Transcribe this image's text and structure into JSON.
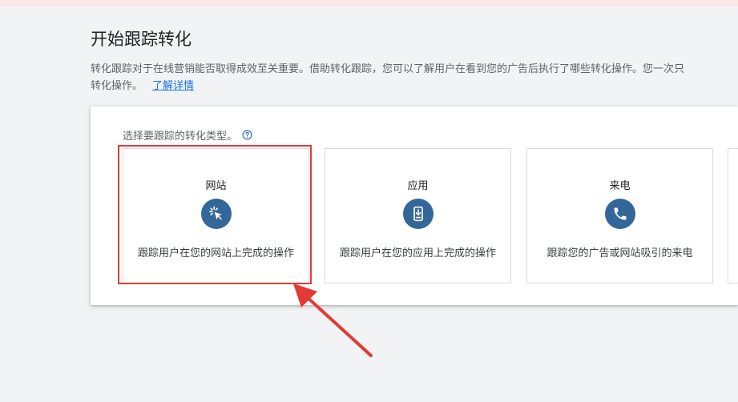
{
  "page": {
    "title": "开始跟踪转化",
    "description_line1": "转化跟踪对于在线营销能否取得成效至关重要。借助转化跟踪，您可以了解用户在看到您的广告后执行了哪些转化操作。您一次只",
    "description_line2": "转化操作。",
    "learn_more": "了解详情"
  },
  "panel": {
    "prompt": "选择要跟踪的转化类型。",
    "help_icon": "help-circle-icon",
    "cards": [
      {
        "title": "网站",
        "icon": "cursor-click-icon",
        "description": "跟踪用户在您的网站上完成的操作",
        "highlighted": true
      },
      {
        "title": "应用",
        "icon": "mobile-download-icon",
        "description": "跟踪用户在您的应用上完成的操作",
        "highlighted": false
      },
      {
        "title": "来电",
        "icon": "phone-icon",
        "description": "跟踪您的广告或网站吸引的来电",
        "highlighted": false
      }
    ]
  },
  "colors": {
    "accent": "#336699",
    "link": "#1a73e8",
    "annotation": "#e53935"
  }
}
